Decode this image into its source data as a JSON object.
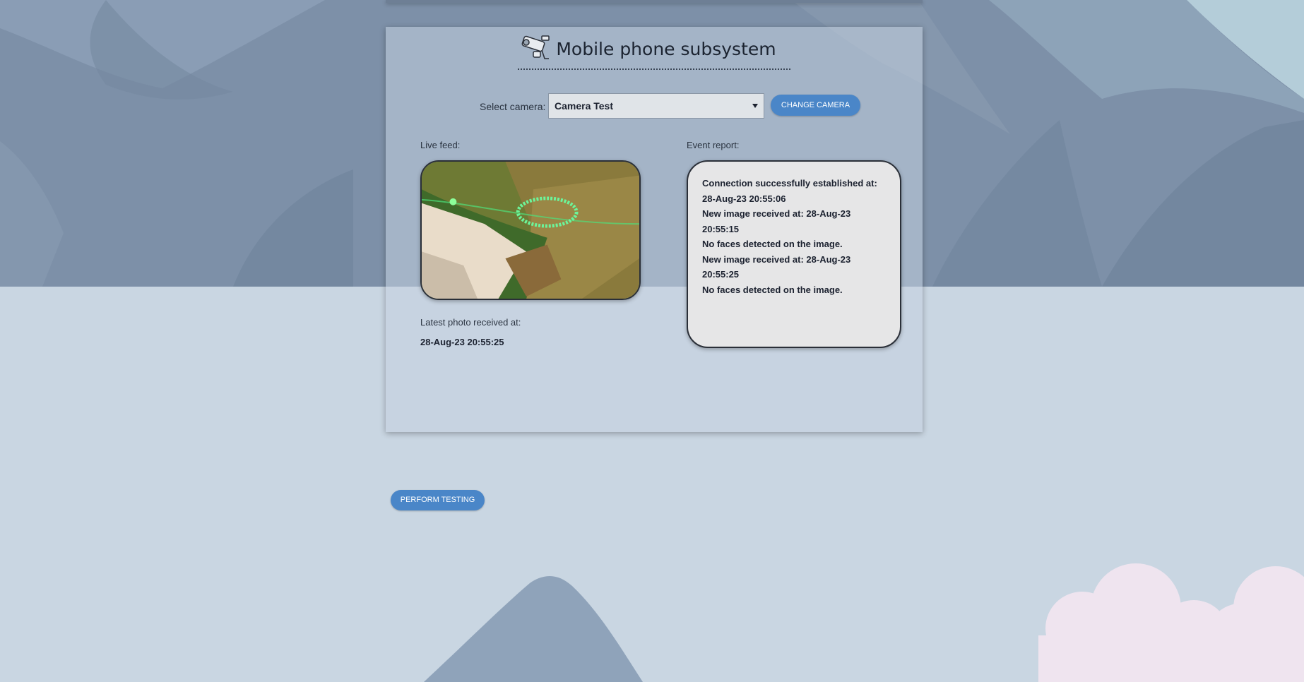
{
  "page": {
    "title": "Mobile phone subsystem"
  },
  "camera_select": {
    "label": "Select camera:",
    "selected": "Camera Test",
    "change_button": "CHANGE CAMERA"
  },
  "live_feed": {
    "label": "Live feed:",
    "latest_label": "Latest photo received at:",
    "latest_time": "28-Aug-23 20:55:25"
  },
  "event_report": {
    "label": "Event report:",
    "lines": [
      "Connection successfully established at:",
      "28-Aug-23 20:55:06",
      "New image received at: 28-Aug-23",
      "20:55:15",
      "No faces detected on the image.",
      "New image received at: 28-Aug-23",
      "20:55:25",
      "No faces detected on the image."
    ]
  },
  "actions": {
    "perform_testing": "PERFORM TESTING"
  },
  "colors": {
    "accent": "#4a86c8",
    "mountain_dark": "#6f849d",
    "sky": "#c9d6e2",
    "cloud": "#f0e6f0"
  },
  "icons": {
    "title_icon": "security-camera-icon",
    "select_caret": "chevron-down-icon"
  }
}
